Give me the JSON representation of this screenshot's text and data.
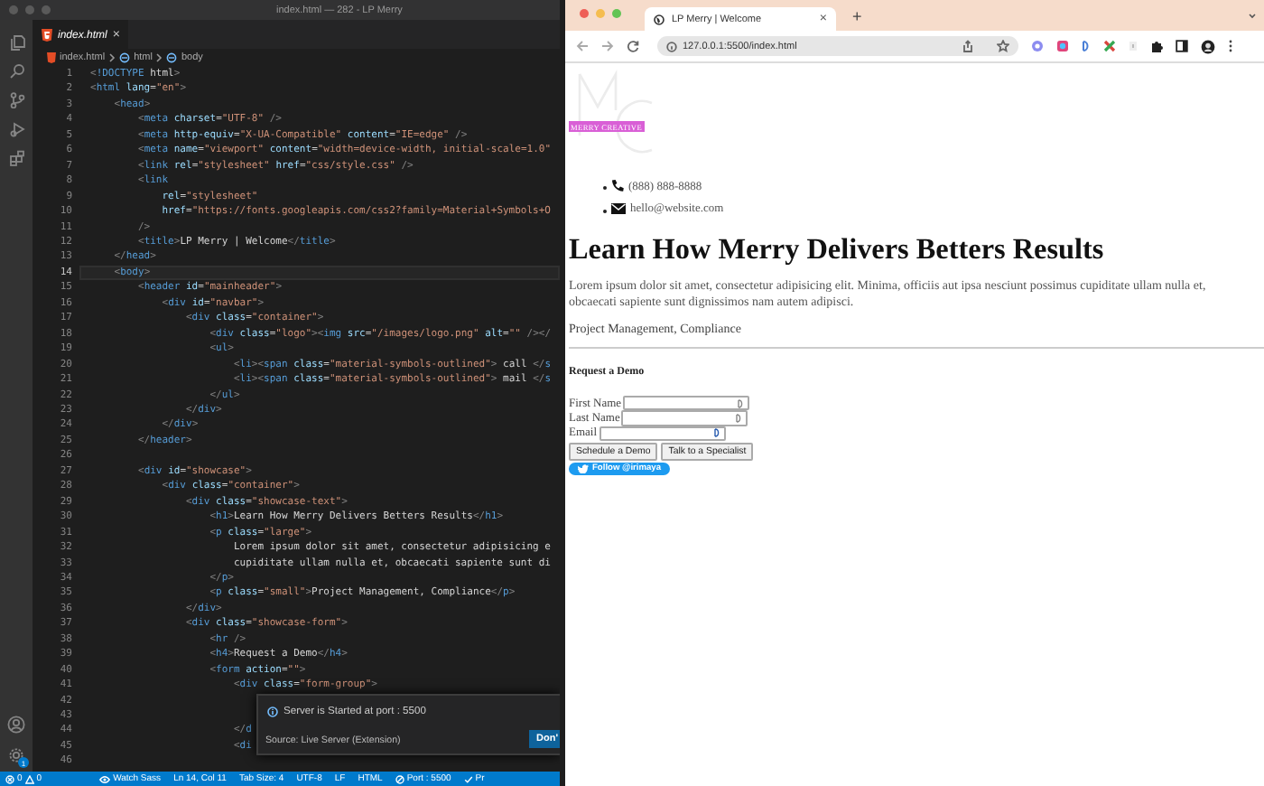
{
  "editor": {
    "window_title": "index.html — 282 - LP Merry",
    "tab": {
      "label": "index.html",
      "close": "×"
    },
    "breadcrumb": [
      "index.html",
      "html",
      "body"
    ],
    "lines": [
      {
        "number": "1",
        "code": "<!DOCTYPE html>",
        "current": false
      },
      {
        "number": "2",
        "code": "<html lang=\"en\">",
        "current": false
      },
      {
        "number": "3",
        "code": "    <head>",
        "current": false
      },
      {
        "number": "4",
        "code": "        <meta charset=\"UTF-8\" />",
        "current": false
      },
      {
        "number": "5",
        "code": "        <meta http-equiv=\"X-UA-Compatible\" content=\"IE=edge\" />",
        "current": false
      },
      {
        "number": "6",
        "code": "        <meta name=\"viewport\" content=\"width=device-width, initial-scale=1.0\"",
        "current": false
      },
      {
        "number": "7",
        "code": "        <link rel=\"stylesheet\" href=\"css/style.css\" />",
        "current": false
      },
      {
        "number": "8",
        "code": "        <link",
        "current": false
      },
      {
        "number": "9",
        "code": "            rel=\"stylesheet\"",
        "current": false
      },
      {
        "number": "10",
        "code": "            href=\"https://fonts.googleapis.com/css2?family=Material+Symbols+O",
        "current": false
      },
      {
        "number": "11",
        "code": "        />",
        "current": false
      },
      {
        "number": "12",
        "code": "        <title>LP Merry | Welcome</title>",
        "current": false
      },
      {
        "number": "13",
        "code": "    </head>",
        "current": false
      },
      {
        "number": "14",
        "code": "    <body>",
        "current": true
      },
      {
        "number": "15",
        "code": "        <header id=\"mainheader\">",
        "current": false
      },
      {
        "number": "16",
        "code": "            <div id=\"navbar\">",
        "current": false
      },
      {
        "number": "17",
        "code": "                <div class=\"container\">",
        "current": false
      },
      {
        "number": "18",
        "code": "                    <div class=\"logo\"><img src=\"/images/logo.png\" alt=\"\" /></",
        "current": false
      },
      {
        "number": "19",
        "code": "                    <ul>",
        "current": false
      },
      {
        "number": "20",
        "code": "                        <li><span class=\"material-symbols-outlined\"> call </s",
        "current": false
      },
      {
        "number": "21",
        "code": "                        <li><span class=\"material-symbols-outlined\"> mail </s",
        "current": false
      },
      {
        "number": "22",
        "code": "                    </ul>",
        "current": false
      },
      {
        "number": "23",
        "code": "                </div>",
        "current": false
      },
      {
        "number": "24",
        "code": "            </div>",
        "current": false
      },
      {
        "number": "25",
        "code": "        </header>",
        "current": false
      },
      {
        "number": "26",
        "current": false
      },
      {
        "number": "27",
        "code": "        <div id=\"showcase\">",
        "current": false
      },
      {
        "number": "28",
        "code": "            <div class=\"container\">",
        "current": false
      },
      {
        "number": "29",
        "code": "                <div class=\"showcase-text\">",
        "current": false
      },
      {
        "number": "30",
        "code": "                    <h1>Learn How Merry Delivers Betters Results</h1>",
        "current": false
      },
      {
        "number": "31",
        "code": "                    <p class=\"large\">",
        "current": false
      },
      {
        "number": "32",
        "code": "                        Lorem ipsum dolor sit amet, consectetur adipisicing e",
        "current": false
      },
      {
        "number": "33",
        "code": "                        cupiditate ullam nulla et, obcaecati sapiente sunt di",
        "current": false
      },
      {
        "number": "34",
        "code": "                    </p>",
        "current": false
      },
      {
        "number": "35",
        "code": "                    <p class=\"small\">Project Management, Compliance</p>",
        "current": false
      },
      {
        "number": "36",
        "code": "                </div>",
        "current": false
      },
      {
        "number": "37",
        "code": "                <div class=\"showcase-form\">",
        "current": false
      },
      {
        "number": "38",
        "code": "                    <hr />",
        "current": false
      },
      {
        "number": "39",
        "code": "                    <h4>Request a Demo</h4>",
        "current": false
      },
      {
        "number": "40",
        "code": "                    <form action=\"\">",
        "current": false
      },
      {
        "number": "41",
        "code": "                        <div class=\"form-group\">",
        "current": false
      },
      {
        "number": "42",
        "current": false
      },
      {
        "number": "43",
        "current": false
      },
      {
        "number": "44",
        "code": "                        </d",
        "current": false
      },
      {
        "number": "45",
        "code": "                        <di",
        "current": false
      },
      {
        "number": "46",
        "current": false
      }
    ],
    "notification": {
      "message": "Server is Started at port : 5500",
      "source": "Source: Live Server (Extension)",
      "button": "Don'"
    },
    "settings_badge": "1",
    "status_bar": {
      "errors": "0",
      "warnings": "0",
      "items": [
        {
          "kind": "watch",
          "text": "Watch Sass"
        },
        {
          "kind": "plain",
          "text": "Ln 14, Col 11"
        },
        {
          "kind": "plain",
          "text": "Tab Size: 4"
        },
        {
          "kind": "plain",
          "text": "UTF-8"
        },
        {
          "kind": "plain",
          "text": "LF"
        },
        {
          "kind": "plain",
          "text": "HTML"
        },
        {
          "kind": "port",
          "text": "Port : 5500"
        },
        {
          "kind": "check",
          "text": "Pr"
        }
      ]
    }
  },
  "browser": {
    "tab": {
      "title": "LP Merry | Welcome",
      "close": "×"
    },
    "new_tab": "+",
    "url": "127.0.0.1:5500/index.html",
    "page": {
      "logo_label": "MERRY CREATIVE",
      "contacts": [
        {
          "kind": "phone",
          "text": "(888) 888-8888"
        },
        {
          "kind": "mail",
          "text": "hello@website.com"
        }
      ],
      "heading": "Learn How Merry Delivers Betters Results",
      "paragraph": "Lorem ipsum dolor sit amet, consectetur adipisicing elit. Minima, officiis aut ipsa nesciunt possimus cupiditate ullam nulla et, obcaecati sapiente sunt dignissimos nam autem adipisci.",
      "small": "Project Management, Compliance",
      "form_title": "Request a Demo",
      "fields": [
        {
          "label": "First Name"
        },
        {
          "label": "Last Name"
        },
        {
          "label": "Email"
        }
      ],
      "buttons": [
        "Schedule a Demo",
        "Talk to a Specialist"
      ],
      "follow_button": "Follow @irimaya"
    }
  }
}
